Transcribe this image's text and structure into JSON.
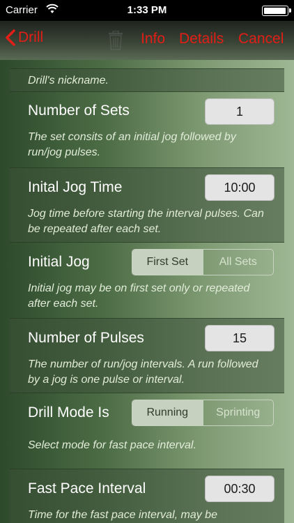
{
  "status_bar": {
    "carrier": "Carrier",
    "time": "1:33 PM",
    "battery_level": 1.0,
    "icons": [
      "wifi-icon",
      "battery-icon"
    ]
  },
  "nav": {
    "back_label": "Drill",
    "info_label": "Info",
    "details_label": "Details",
    "cancel_label": "Cancel",
    "accent_color": "#e31e17",
    "icons": [
      "chevron-left-icon",
      "trash-icon"
    ]
  },
  "form": {
    "nickname_desc": "Drill's nickname.",
    "number_of_sets": {
      "label": "Number of Sets",
      "value": "1",
      "desc": "The set consits of an initial jog followed by run/jog pulses."
    },
    "initial_jog_time": {
      "label": "Inital Jog Time",
      "value": "10:00",
      "desc": "Jog time before starting the interval pulses. Can be repeated after each set."
    },
    "initial_jog": {
      "label": "Initial Jog",
      "options": [
        "First Set",
        "All Sets"
      ],
      "selected": "First Set",
      "desc": "Initial jog may be on first set only or repeated after each set."
    },
    "number_of_pulses": {
      "label": "Number of Pulses",
      "value": "15",
      "desc": "The number of run/jog intervals. A run followed by a jog is one pulse or interval."
    },
    "drill_mode": {
      "label": "Drill Mode Is",
      "options": [
        "Running",
        "Sprinting"
      ],
      "selected": "Running",
      "desc": "Select mode for fast pace interval."
    },
    "fast_pace_interval": {
      "label": "Fast Pace Interval",
      "value": "00:30",
      "desc": "Time for the fast pace interval, may be"
    }
  }
}
